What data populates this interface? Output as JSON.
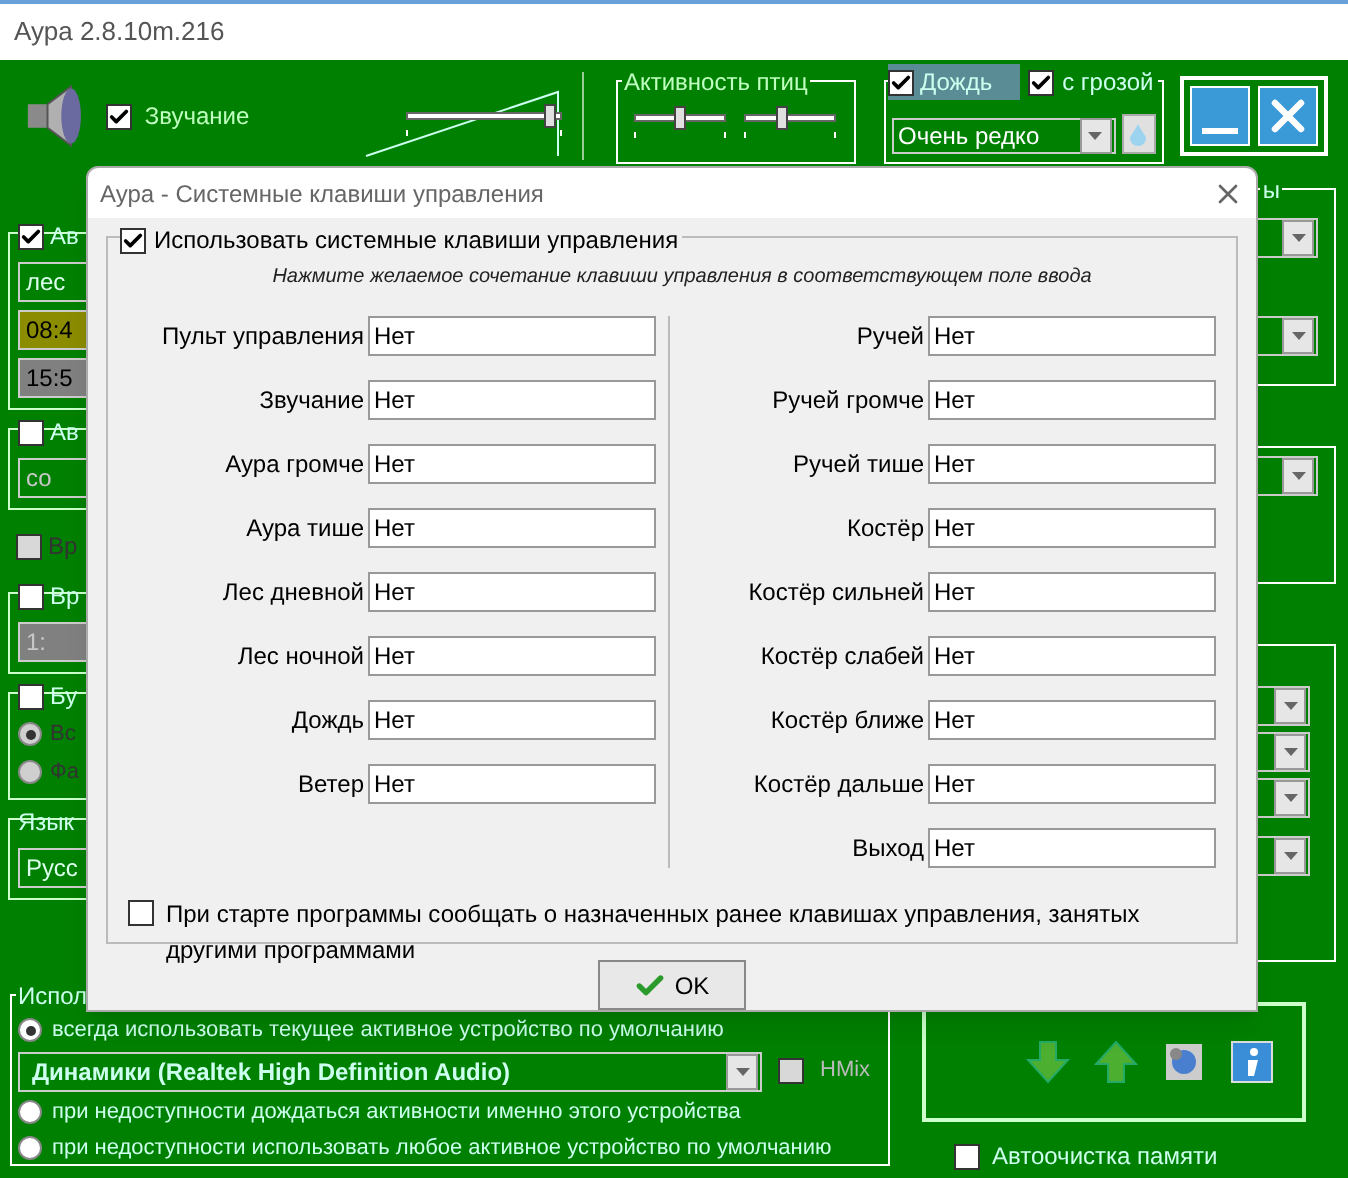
{
  "window": {
    "title": "Аура 2.8.10m.216"
  },
  "toolbar": {
    "sound": {
      "label": "Звучание",
      "checked": true
    },
    "volume": {
      "level": 0.93
    },
    "birds": {
      "title": "Активность птиц",
      "sliders": [
        {
          "level": 0.5
        },
        {
          "level": 0.4
        }
      ]
    },
    "rain": {
      "label": "Дождь",
      "checked": true
    },
    "thunder": {
      "label": "с грозой",
      "checked": true
    },
    "frequency": "Очень редко"
  },
  "left_panel": [
    {
      "boxed": true,
      "items": [
        {
          "kind": "checkbox",
          "label": "Ав",
          "checked": true
        },
        {
          "kind": "field",
          "value": "лес",
          "color": "#008000"
        },
        {
          "kind": "field",
          "value": "08:4",
          "color": "#8c8c00"
        },
        {
          "kind": "field",
          "value": "15:5",
          "color": "#808080"
        }
      ]
    },
    {
      "boxed": true,
      "items": [
        {
          "kind": "checkbox",
          "label": "Ав",
          "checked": false
        },
        {
          "kind": "field",
          "value": "со",
          "color": "#008000",
          "disabled": true
        }
      ]
    },
    {
      "boxed": false,
      "items": [
        {
          "kind": "checkbox",
          "label": "Вр",
          "checked": false,
          "disabled": true
        }
      ]
    },
    {
      "boxed": true,
      "items": [
        {
          "kind": "checkbox",
          "label": "Вр",
          "checked": false
        },
        {
          "kind": "field",
          "value": "1:",
          "color": "#808080",
          "disabled": true
        }
      ]
    },
    {
      "boxed": true,
      "items": [
        {
          "kind": "checkbox",
          "label": "Бу",
          "checked": false
        },
        {
          "kind": "radio",
          "label": "Вс",
          "selected": true,
          "disabled": true
        },
        {
          "kind": "radio",
          "label": "Фа",
          "selected": false,
          "disabled": true
        }
      ]
    },
    {
      "boxed": true,
      "title": "Язык",
      "items": [
        {
          "kind": "field",
          "value": "Русс",
          "color": "#008000"
        }
      ]
    }
  ],
  "right_panel": {
    "title": "ы"
  },
  "output": {
    "title": "Испол",
    "radios": [
      {
        "label": "всегда использовать текущее активное устройство по умолчанию",
        "selected": true
      },
      {
        "label": "при недоступности дождаться активности именно этого устройства",
        "selected": false
      },
      {
        "label": "при недоступности использовать любое активное устройство по умолчанию",
        "selected": false
      }
    ],
    "device": "Динамики (Realtek High Definition Audio)",
    "hmix": {
      "label": "HMix",
      "checked": false,
      "disabled": true
    }
  },
  "memory": {
    "label": "Автоочистка памяти",
    "checked": false
  },
  "dialog": {
    "title": "Аура - Системные клавиши управления",
    "use_keys": {
      "label": "Использовать системные клавиши управления",
      "checked": true
    },
    "hint": "Нажмите желаемое сочетание клавиши управления в соответствующем поле ввода",
    "left": [
      {
        "label": "Пульт управления",
        "value": "Нет"
      },
      {
        "label": "Звучание",
        "value": "Нет"
      },
      {
        "label": "Аура громче",
        "value": "Нет"
      },
      {
        "label": "Аура тише",
        "value": "Нет"
      },
      {
        "label": "Лес дневной",
        "value": "Нет"
      },
      {
        "label": "Лес ночной",
        "value": "Нет"
      },
      {
        "label": "Дождь",
        "value": "Нет"
      },
      {
        "label": "Ветер",
        "value": "Нет"
      }
    ],
    "right": [
      {
        "label": "Ручей",
        "value": "Нет"
      },
      {
        "label": "Ручей громче",
        "value": "Нет"
      },
      {
        "label": "Ручей тише",
        "value": "Нет"
      },
      {
        "label": "Костёр",
        "value": "Нет"
      },
      {
        "label": "Костёр сильней",
        "value": "Нет"
      },
      {
        "label": "Костёр слабей",
        "value": "Нет"
      },
      {
        "label": "Костёр ближе",
        "value": "Нет"
      },
      {
        "label": "Костёр дальше",
        "value": "Нет"
      },
      {
        "label": "Выход",
        "value": "Нет"
      }
    ],
    "notify": {
      "label": "При старте программы сообщать о назначенных ранее клавишах управления, занятых другими программами",
      "checked": false
    },
    "ok": "OK"
  }
}
